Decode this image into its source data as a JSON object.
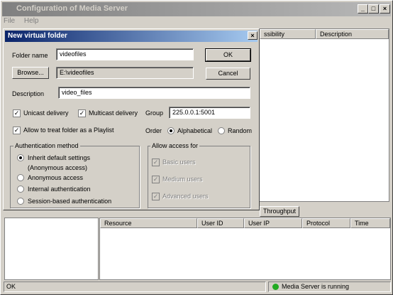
{
  "window": {
    "title": "Configuration of Media Server",
    "minimize": "_",
    "maximize": "□",
    "close": "×"
  },
  "menu": {
    "items": [
      "File",
      "Help"
    ]
  },
  "folder_table": {
    "columns": [
      "ssibility",
      "Description"
    ]
  },
  "throughput_tab": "Throughput",
  "session_table": {
    "columns": [
      "Resource",
      "User ID",
      "User IP",
      "Protocol",
      "Time"
    ]
  },
  "status": {
    "left": "OK",
    "right": "Media Server is running",
    "indicator_color": "#22aa22"
  },
  "dialog": {
    "title": "New virtual folder",
    "close": "×",
    "folder_name_label": "Folder name",
    "folder_name_value": "videofiles",
    "ok_label": "OK",
    "browse_label": "Browse...",
    "path_value": "E:\\videofiles",
    "cancel_label": "Cancel",
    "description_label": "Description",
    "description_value": "video_files",
    "unicast_label": "Unicast delivery",
    "unicast_checked": true,
    "multicast_label": "Multicast delivery",
    "multicast_checked": true,
    "group_label": "Group",
    "group_value": "225.0.0.1:5001",
    "playlist_label": "Allow to treat folder as a Playlist",
    "playlist_checked": true,
    "order_label": "Order",
    "order_options": [
      "Alphabetical",
      "Random"
    ],
    "order_selected": "Alphabetical",
    "auth_title": "Authentication method",
    "auth_options": [
      "Inherit default settings",
      "Anonymous access",
      "Internal authentication",
      "Session-based authentication"
    ],
    "auth_inherit_note": "(Anonymous access)",
    "auth_selected": "Inherit default settings",
    "access_title": "Allow access for",
    "access_options": [
      "Basic users",
      "Medium users",
      "Advanced users"
    ]
  }
}
